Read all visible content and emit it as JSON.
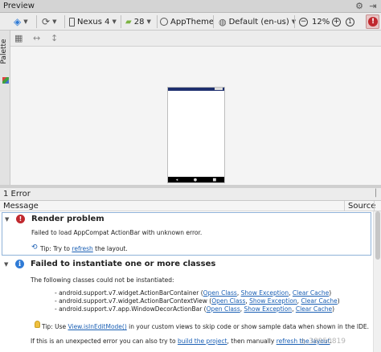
{
  "window": {
    "title": "Preview"
  },
  "toolbar": {
    "device": "Nexus 4",
    "api_level": "28",
    "theme": "AppTheme",
    "locale": "Default (en-us)",
    "zoom": "12%"
  },
  "sidebar": {
    "palette_label": "Palette"
  },
  "errors_panel": {
    "title": "1 Error",
    "col_message": "Message",
    "col_source": "Source"
  },
  "render_problem": {
    "title": "Render problem",
    "body": "Failed to load AppCompat ActionBar with unknown error.",
    "tip_prefix": "Tip: Try to ",
    "tip_link": "refresh",
    "tip_suffix": " the layout."
  },
  "instantiate": {
    "title": "Failed to instantiate one or more classes",
    "body": "The following classes could not be instantiated:",
    "classes": [
      "- android.support.v7.widget.ActionBarContainer",
      "- android.support.v7.widget.ActionBarContextView",
      "- android.support.v7.app.WindowDecorActionBar"
    ],
    "open_class": "Open Class",
    "show_exception": "Show Exception",
    "clear_cache": "Clear Cache",
    "tip_prefix": "Tip: Use ",
    "tip_link": "View.isInEditMode()",
    "tip_suffix": " in your custom views to skip code or show sample data when shown in the IDE.",
    "unexpected_prefix": "If this is an unexpected error you can also try to ",
    "build_link": "build the project",
    "unexpected_mid": ", then manually ",
    "refresh_link": "refresh the layout",
    "unexpected_suffix": "."
  },
  "watermark": "q_38950819",
  "colors": {
    "error": "#c0282e",
    "info": "#2f7bd6",
    "link": "#1a5fb4",
    "device_statusbar": "#1e2f6e"
  }
}
